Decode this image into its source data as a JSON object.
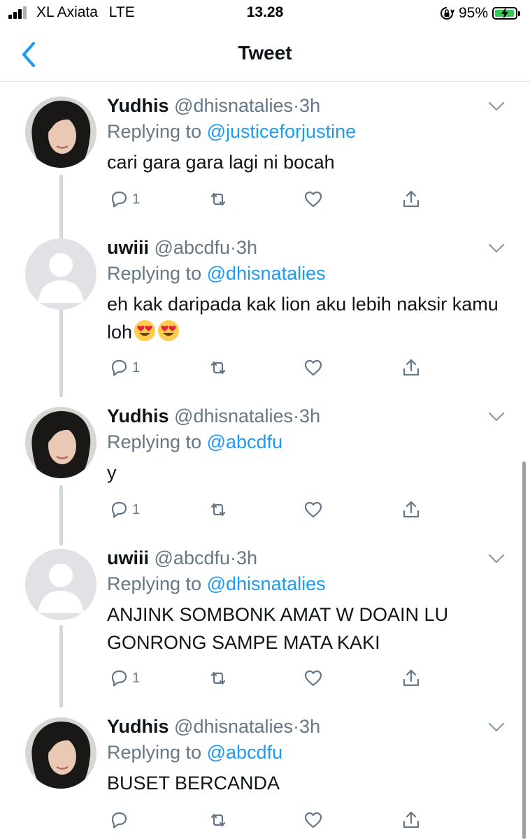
{
  "status_bar": {
    "carrier": "XL Axiata",
    "network": "LTE",
    "time": "13.28",
    "battery_percent": "95%",
    "battery_level": 0.95
  },
  "header": {
    "title": "Tweet"
  },
  "replying_label": "Replying to",
  "colors": {
    "accent": "#1d9bf0",
    "muted": "#657786",
    "line": "#cfd9de",
    "battery": "#34c759"
  },
  "tweets": [
    {
      "name": "Yudhis",
      "handle": "@dhisnatalies",
      "sep": "·",
      "time": "3h",
      "replying_to": "@justiceforjustine",
      "text": "cari gara gara lagi ni bocah",
      "reply_count": "1"
    },
    {
      "name": "uwiii",
      "handle": "@abcdfu",
      "sep": "·",
      "time": "3h",
      "replying_to": "@dhisnatalies",
      "text": "eh kak daripada kak lion aku lebih naksir kamu loh",
      "emojis": [
        "heart-eyes-emoji",
        "heart-eyes-emoji"
      ],
      "reply_count": "1"
    },
    {
      "name": "Yudhis",
      "handle": "@dhisnatalies",
      "sep": "·",
      "time": "3h",
      "replying_to": "@abcdfu",
      "text": "y",
      "reply_count": "1"
    },
    {
      "name": "uwiii",
      "handle": "@abcdfu",
      "sep": "·",
      "time": "3h",
      "replying_to": "@dhisnatalies",
      "text": "ANJINK SOMBONK AMAT W DOAIN LU GONRONG SAMPE MATA KAKI",
      "reply_count": "1"
    },
    {
      "name": "Yudhis",
      "handle": "@dhisnatalies",
      "sep": "·",
      "time": "3h",
      "replying_to": "@abcdfu",
      "text": "BUSET BERCANDA",
      "reply_count": ""
    }
  ]
}
